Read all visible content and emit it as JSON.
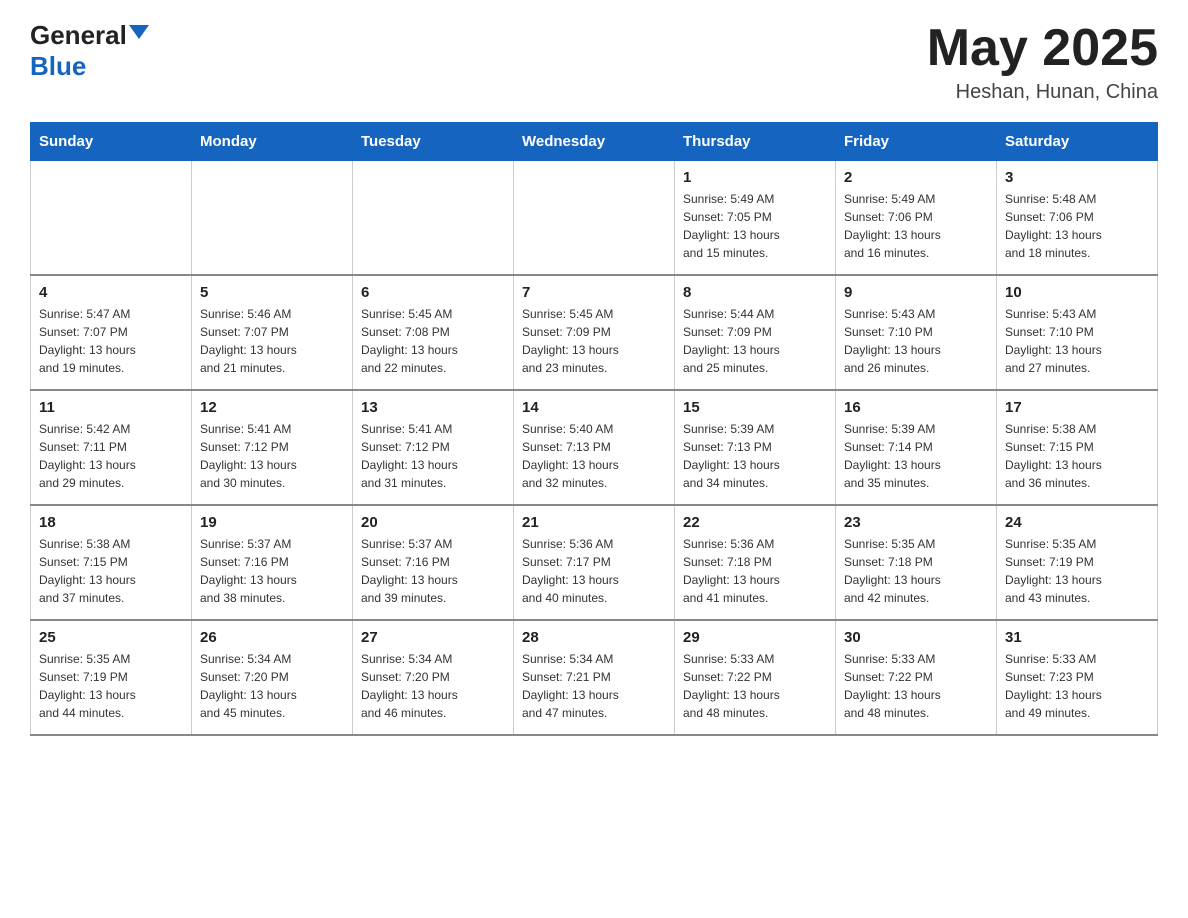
{
  "header": {
    "logo_general": "General",
    "logo_blue": "Blue",
    "month_year": "May 2025",
    "location": "Heshan, Hunan, China"
  },
  "days_of_week": [
    "Sunday",
    "Monday",
    "Tuesday",
    "Wednesday",
    "Thursday",
    "Friday",
    "Saturday"
  ],
  "weeks": [
    [
      {
        "day": "",
        "info": ""
      },
      {
        "day": "",
        "info": ""
      },
      {
        "day": "",
        "info": ""
      },
      {
        "day": "",
        "info": ""
      },
      {
        "day": "1",
        "info": "Sunrise: 5:49 AM\nSunset: 7:05 PM\nDaylight: 13 hours\nand 15 minutes."
      },
      {
        "day": "2",
        "info": "Sunrise: 5:49 AM\nSunset: 7:06 PM\nDaylight: 13 hours\nand 16 minutes."
      },
      {
        "day": "3",
        "info": "Sunrise: 5:48 AM\nSunset: 7:06 PM\nDaylight: 13 hours\nand 18 minutes."
      }
    ],
    [
      {
        "day": "4",
        "info": "Sunrise: 5:47 AM\nSunset: 7:07 PM\nDaylight: 13 hours\nand 19 minutes."
      },
      {
        "day": "5",
        "info": "Sunrise: 5:46 AM\nSunset: 7:07 PM\nDaylight: 13 hours\nand 21 minutes."
      },
      {
        "day": "6",
        "info": "Sunrise: 5:45 AM\nSunset: 7:08 PM\nDaylight: 13 hours\nand 22 minutes."
      },
      {
        "day": "7",
        "info": "Sunrise: 5:45 AM\nSunset: 7:09 PM\nDaylight: 13 hours\nand 23 minutes."
      },
      {
        "day": "8",
        "info": "Sunrise: 5:44 AM\nSunset: 7:09 PM\nDaylight: 13 hours\nand 25 minutes."
      },
      {
        "day": "9",
        "info": "Sunrise: 5:43 AM\nSunset: 7:10 PM\nDaylight: 13 hours\nand 26 minutes."
      },
      {
        "day": "10",
        "info": "Sunrise: 5:43 AM\nSunset: 7:10 PM\nDaylight: 13 hours\nand 27 minutes."
      }
    ],
    [
      {
        "day": "11",
        "info": "Sunrise: 5:42 AM\nSunset: 7:11 PM\nDaylight: 13 hours\nand 29 minutes."
      },
      {
        "day": "12",
        "info": "Sunrise: 5:41 AM\nSunset: 7:12 PM\nDaylight: 13 hours\nand 30 minutes."
      },
      {
        "day": "13",
        "info": "Sunrise: 5:41 AM\nSunset: 7:12 PM\nDaylight: 13 hours\nand 31 minutes."
      },
      {
        "day": "14",
        "info": "Sunrise: 5:40 AM\nSunset: 7:13 PM\nDaylight: 13 hours\nand 32 minutes."
      },
      {
        "day": "15",
        "info": "Sunrise: 5:39 AM\nSunset: 7:13 PM\nDaylight: 13 hours\nand 34 minutes."
      },
      {
        "day": "16",
        "info": "Sunrise: 5:39 AM\nSunset: 7:14 PM\nDaylight: 13 hours\nand 35 minutes."
      },
      {
        "day": "17",
        "info": "Sunrise: 5:38 AM\nSunset: 7:15 PM\nDaylight: 13 hours\nand 36 minutes."
      }
    ],
    [
      {
        "day": "18",
        "info": "Sunrise: 5:38 AM\nSunset: 7:15 PM\nDaylight: 13 hours\nand 37 minutes."
      },
      {
        "day": "19",
        "info": "Sunrise: 5:37 AM\nSunset: 7:16 PM\nDaylight: 13 hours\nand 38 minutes."
      },
      {
        "day": "20",
        "info": "Sunrise: 5:37 AM\nSunset: 7:16 PM\nDaylight: 13 hours\nand 39 minutes."
      },
      {
        "day": "21",
        "info": "Sunrise: 5:36 AM\nSunset: 7:17 PM\nDaylight: 13 hours\nand 40 minutes."
      },
      {
        "day": "22",
        "info": "Sunrise: 5:36 AM\nSunset: 7:18 PM\nDaylight: 13 hours\nand 41 minutes."
      },
      {
        "day": "23",
        "info": "Sunrise: 5:35 AM\nSunset: 7:18 PM\nDaylight: 13 hours\nand 42 minutes."
      },
      {
        "day": "24",
        "info": "Sunrise: 5:35 AM\nSunset: 7:19 PM\nDaylight: 13 hours\nand 43 minutes."
      }
    ],
    [
      {
        "day": "25",
        "info": "Sunrise: 5:35 AM\nSunset: 7:19 PM\nDaylight: 13 hours\nand 44 minutes."
      },
      {
        "day": "26",
        "info": "Sunrise: 5:34 AM\nSunset: 7:20 PM\nDaylight: 13 hours\nand 45 minutes."
      },
      {
        "day": "27",
        "info": "Sunrise: 5:34 AM\nSunset: 7:20 PM\nDaylight: 13 hours\nand 46 minutes."
      },
      {
        "day": "28",
        "info": "Sunrise: 5:34 AM\nSunset: 7:21 PM\nDaylight: 13 hours\nand 47 minutes."
      },
      {
        "day": "29",
        "info": "Sunrise: 5:33 AM\nSunset: 7:22 PM\nDaylight: 13 hours\nand 48 minutes."
      },
      {
        "day": "30",
        "info": "Sunrise: 5:33 AM\nSunset: 7:22 PM\nDaylight: 13 hours\nand 48 minutes."
      },
      {
        "day": "31",
        "info": "Sunrise: 5:33 AM\nSunset: 7:23 PM\nDaylight: 13 hours\nand 49 minutes."
      }
    ]
  ]
}
